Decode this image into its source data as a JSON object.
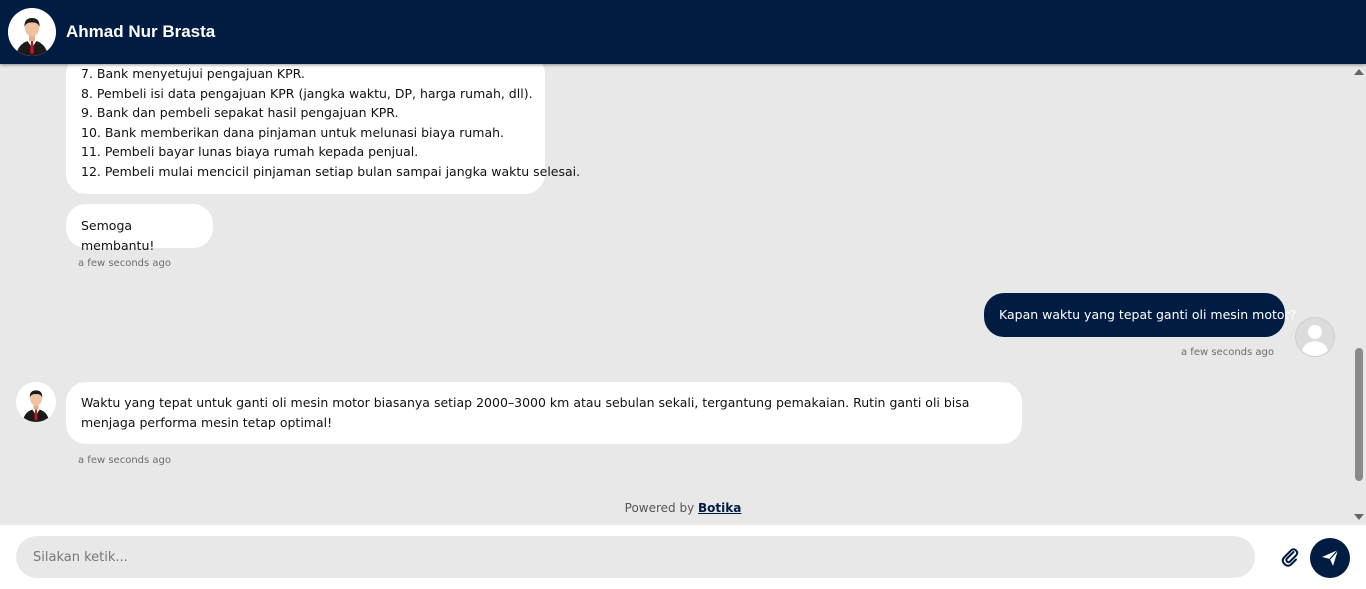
{
  "header": {
    "title": "Ahmad Nur Brasta",
    "avatar_icon": "businessman-avatar-icon"
  },
  "messages": [
    {
      "sender": "bot",
      "lines": [
        "7. Bank menyetujui pengajuan KPR.",
        "8. Pembeli isi data pengajuan KPR (jangka waktu, DP, harga rumah, dll).",
        "9. Bank dan pembeli sepakat hasil pengajuan KPR.",
        "10. Bank memberikan dana pinjaman untuk melunasi biaya rumah.",
        "11. Pembeli bayar lunas biaya rumah kepada penjual.",
        "12. Pembeli mulai mencicil pinjaman setiap bulan sampai jangka waktu selesai."
      ]
    },
    {
      "sender": "bot",
      "text": "Semoga membantu!",
      "time": "a few seconds ago"
    },
    {
      "sender": "user",
      "text": "Kapan waktu yang tepat ganti oli mesin motor?",
      "time": "a few seconds ago"
    },
    {
      "sender": "bot",
      "text": "Waktu yang tepat untuk ganti oli mesin motor biasanya setiap 2000–3000 km atau sebulan sekali, tergantung pemakaian. Rutin ganti oli bisa menjaga performa mesin tetap optimal!",
      "time": "a few seconds ago"
    }
  ],
  "powered": {
    "prefix": "Powered by",
    "brand": "Botika"
  },
  "composer": {
    "placeholder": "Silakan ketik...",
    "attach_icon": "paperclip-icon",
    "send_icon": "send-icon"
  },
  "colors": {
    "primary": "#011c43",
    "chat_bg": "#e8e8e8",
    "bubble_bot": "#ffffff"
  }
}
